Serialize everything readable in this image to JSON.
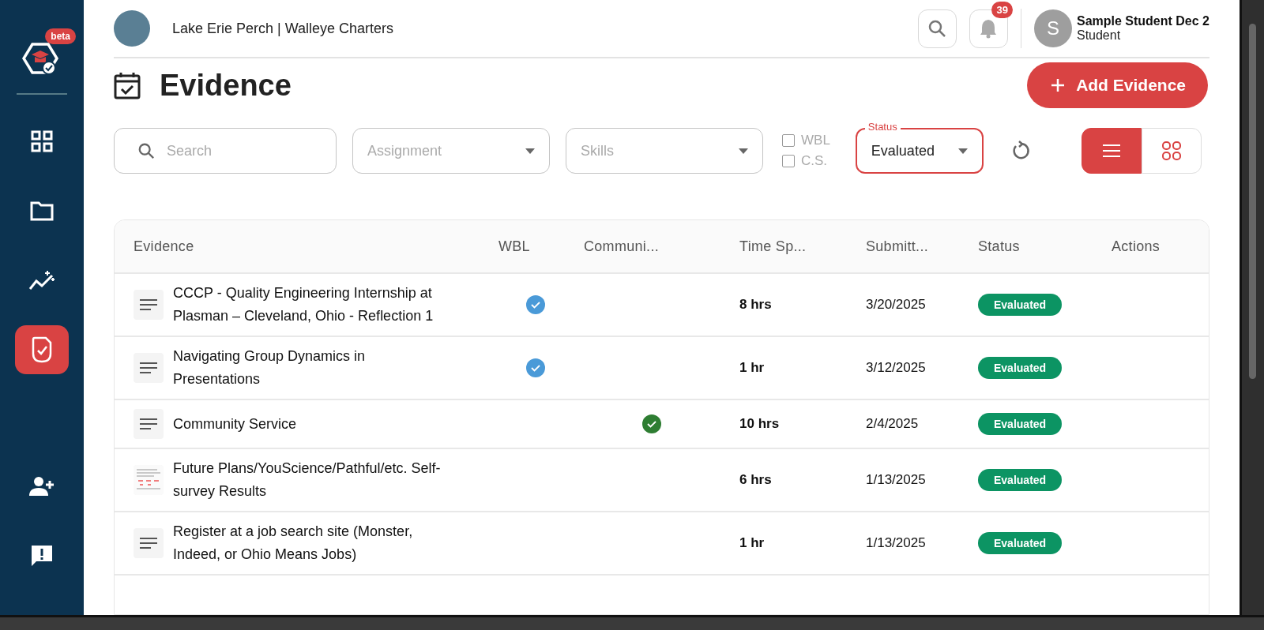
{
  "sidebar": {
    "beta_badge": "beta",
    "items": [
      {
        "selected": false
      },
      {
        "selected": false
      },
      {
        "selected": false
      },
      {
        "selected": true
      }
    ],
    "bottom_items": [
      {
        "selected": false
      },
      {
        "selected": false
      }
    ]
  },
  "header": {
    "company": "Lake Erie Perch | Walleye Charters",
    "notification_count": "39",
    "user": {
      "initial": "S",
      "name": "Sample Student Dec 2",
      "role": "Student"
    }
  },
  "page": {
    "title": "Evidence",
    "add_button": "Add Evidence"
  },
  "filters": {
    "search": {
      "placeholder": "Search"
    },
    "assignment": {
      "placeholder": "Assignment"
    },
    "skills": {
      "placeholder": "Skills"
    },
    "checkboxes": [
      {
        "label": "WBL",
        "checked": false
      },
      {
        "label": "C.S.",
        "checked": false
      }
    ],
    "status": {
      "label": "Status",
      "value": "Evaluated"
    },
    "views": [
      {
        "kind": "list",
        "selected": true
      },
      {
        "kind": "grid",
        "selected": false
      }
    ]
  },
  "table": {
    "columns": [
      "Evidence",
      "WBL",
      "Communi...",
      "Time Sp...",
      "Submitt...",
      "Status",
      "Actions"
    ],
    "rows": [
      {
        "kind": "text",
        "title": "CCCP - Quality Engineering Internship at Plasman – Cleveland, Ohio - Reflection 1",
        "wbl": true,
        "community_service": false,
        "time": "8 hrs",
        "submitted": "3/20/2025",
        "status": "Evaluated"
      },
      {
        "kind": "text",
        "title": "Navigating Group Dynamics in Presentations",
        "wbl": true,
        "community_service": false,
        "time": "1 hr",
        "submitted": "3/12/2025",
        "status": "Evaluated"
      },
      {
        "kind": "text",
        "title": "Community Service",
        "wbl": false,
        "community_service": true,
        "time": "10 hrs",
        "submitted": "2/4/2025",
        "status": "Evaluated"
      },
      {
        "kind": "image",
        "title": "Future Plans/YouScience/Pathful/etc. Self-survey Results",
        "wbl": false,
        "community_service": false,
        "time": "6 hrs",
        "submitted": "1/13/2025",
        "status": "Evaluated"
      },
      {
        "kind": "text",
        "title": "Register at a job search site (Monster, Indeed, or Ohio Means Jobs)",
        "wbl": false,
        "community_service": false,
        "time": "1 hr",
        "submitted": "1/13/2025",
        "status": "Evaluated"
      }
    ]
  }
}
